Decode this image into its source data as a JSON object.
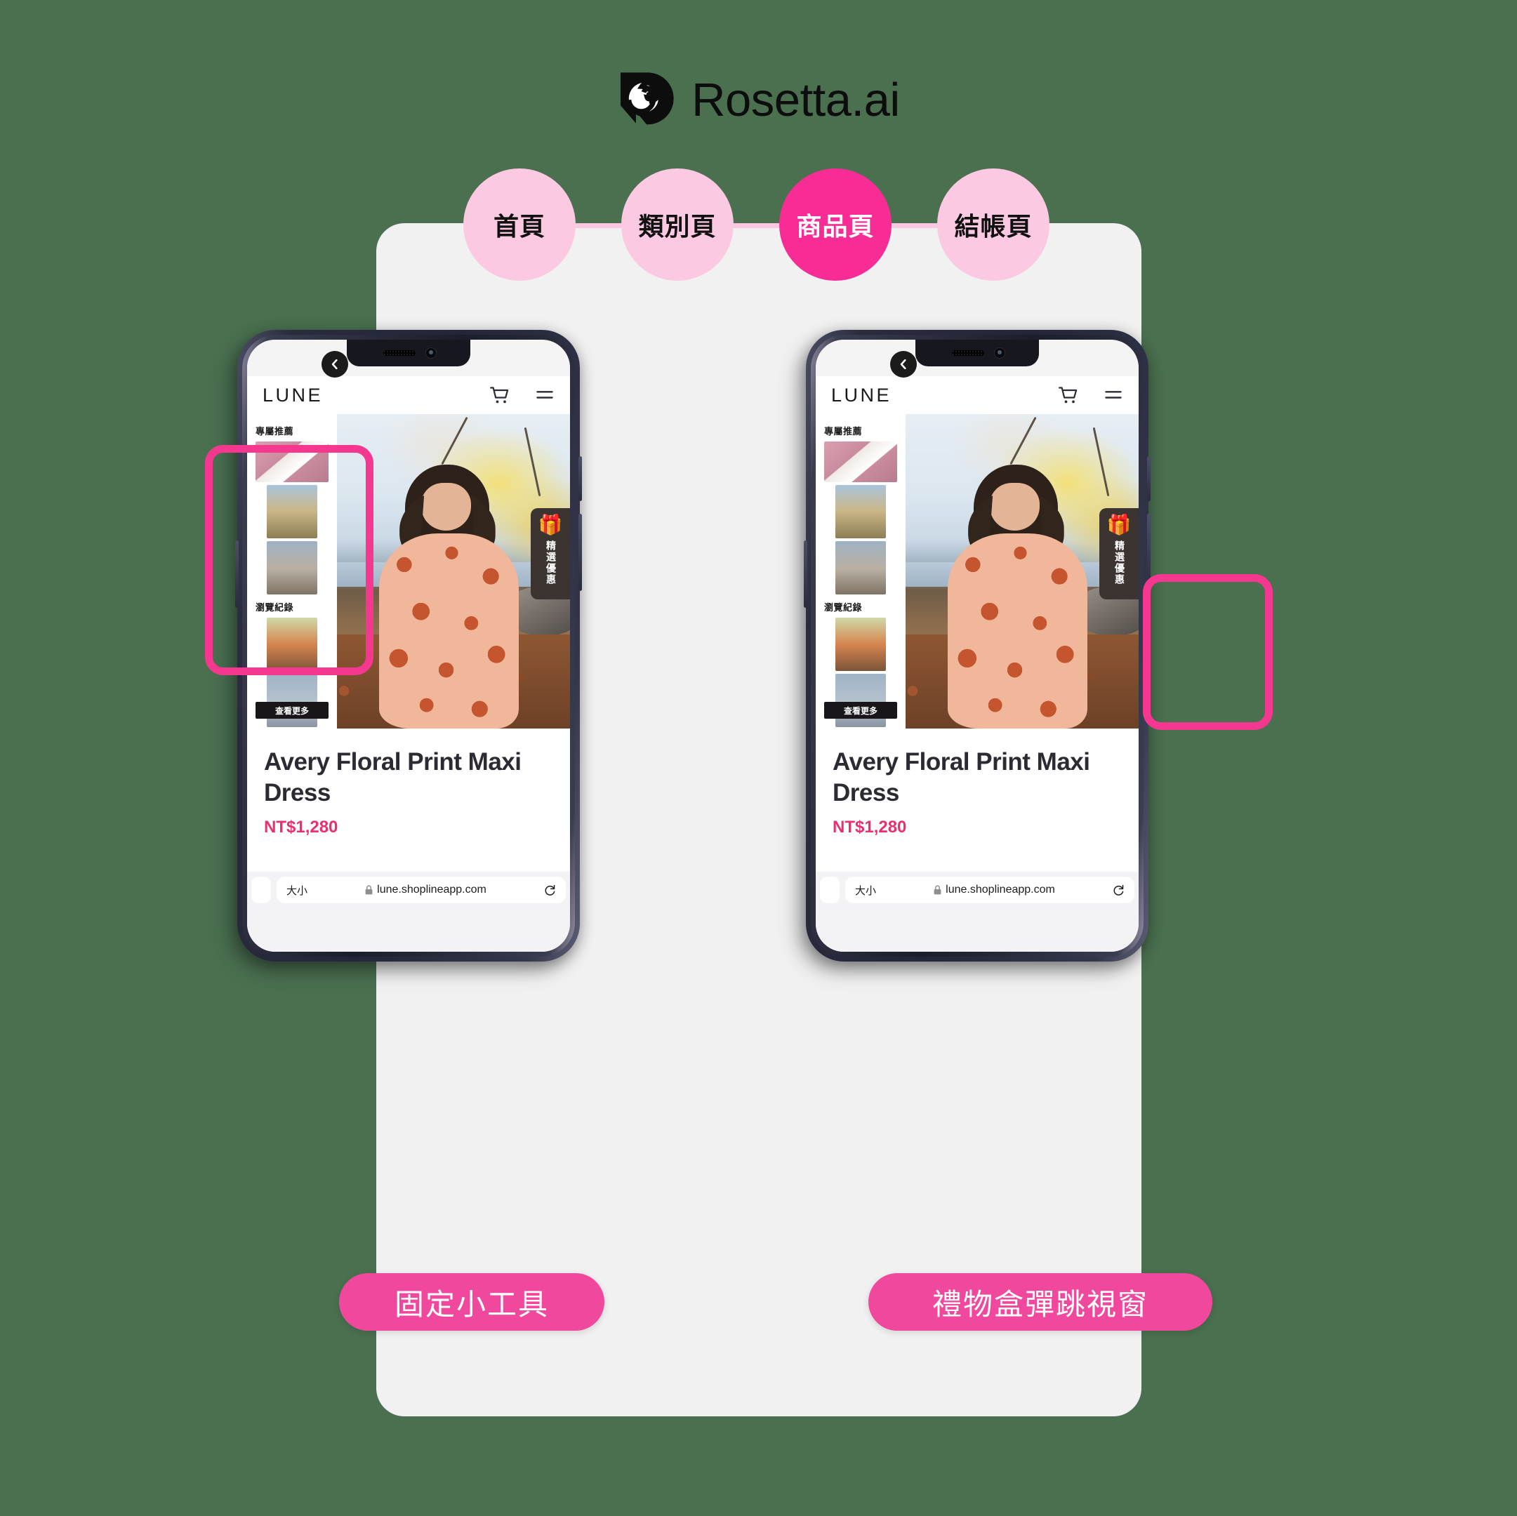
{
  "theme": {
    "background": "#4a7050",
    "card": "#f1f1f1",
    "pink_active": "#f72c95",
    "pink_light": "#fcc9e2",
    "pink_label": "#f0489d",
    "highlight": "#f4388f"
  },
  "logo": {
    "icon": "spiral-shell-icon",
    "text": "Rosetta.ai"
  },
  "steps": [
    {
      "label": "首頁",
      "active": false
    },
    {
      "label": "類別頁",
      "active": false
    },
    {
      "label": "商品頁",
      "active": true
    },
    {
      "label": "結帳頁",
      "active": false
    }
  ],
  "phones": [
    {
      "id": "phone-fixed-widget",
      "site": {
        "brand": "LUNE",
        "cart_icon": "shopping-cart-icon",
        "menu_icon": "hamburger-menu-icon",
        "back_icon": "chevron-left-icon"
      },
      "sidebar": {
        "visible": true,
        "section_recommend": "專屬推薦",
        "section_history": "瀏覽紀錄",
        "more_button": "查看更多",
        "recommend_thumbs": [
          "product-bottles",
          "model-wheat-field",
          "model-lake"
        ],
        "history_thumbs": [
          "model-floral-dress",
          "model-beach"
        ]
      },
      "gift": {
        "visible": true,
        "icon": "gift-box-icon",
        "label": "精選優惠"
      },
      "product": {
        "title": "Avery Floral Print Maxi Dress",
        "price": "NT$1,280"
      },
      "browser": {
        "size_label": "大小",
        "lock_icon": "lock-icon",
        "url": "lune.shoplineapp.com",
        "reload_icon": "reload-icon"
      },
      "highlight_target": "sidebar",
      "caption": "固定小工具"
    },
    {
      "id": "phone-gift-popup",
      "site": {
        "brand": "LUNE",
        "cart_icon": "shopping-cart-icon",
        "menu_icon": "hamburger-menu-icon",
        "back_icon": "chevron-left-icon"
      },
      "sidebar": {
        "visible": true,
        "section_recommend": "專屬推薦",
        "section_history": "瀏覽紀錄",
        "more_button": "查看更多",
        "recommend_thumbs": [
          "product-bottles",
          "model-wheat-field",
          "model-lake"
        ],
        "history_thumbs": [
          "model-floral-dress",
          "model-beach"
        ]
      },
      "gift": {
        "visible": true,
        "icon": "gift-box-icon",
        "label": "精選優惠"
      },
      "product": {
        "title": "Avery Floral Print Maxi Dress",
        "price": "NT$1,280"
      },
      "browser": {
        "size_label": "大小",
        "lock_icon": "lock-icon",
        "url": "lune.shoplineapp.com",
        "reload_icon": "reload-icon"
      },
      "highlight_target": "gift",
      "caption": "禮物盒彈跳視窗"
    }
  ],
  "captions": {
    "left": "固定小工具",
    "right": "禮物盒彈跳視窗"
  }
}
